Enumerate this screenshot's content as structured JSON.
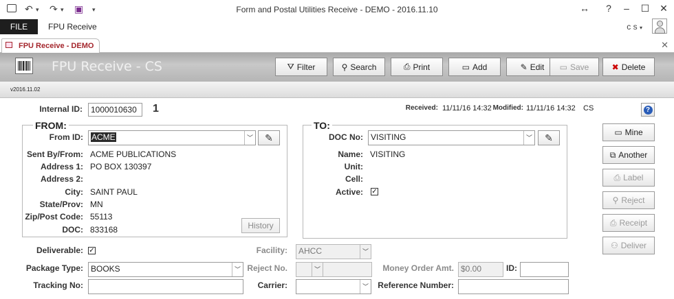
{
  "window": {
    "title": "Form and Postal Utilities Receive - DEMO - 2016.11.10",
    "controls": {
      "resize": "↔",
      "help": "?",
      "minimize": "–",
      "maximize": "☐",
      "close": "✕"
    }
  },
  "qat": {
    "undo": "↶",
    "redo": "↷",
    "save": "▣",
    "more": "▾"
  },
  "ribbon": {
    "file": "FILE",
    "tab": "FPU Receive",
    "user": "c s"
  },
  "doc_tab": {
    "label": "FPU Receive - DEMO",
    "close": "✕"
  },
  "header": {
    "title": "FPU Receive - CS",
    "version": "v2016.11.02"
  },
  "toolbar": {
    "filter": "Filter",
    "search": "Search",
    "print": "Print",
    "add": "Add",
    "edit": "Edit",
    "save": "Save",
    "delete": "Delete"
  },
  "info": {
    "internal_id_label": "Internal ID:",
    "internal_id": "1000010630",
    "count": "1",
    "received_label": "Received:",
    "received": "11/11/16 14:32",
    "modified_label": "Modified:",
    "modified": "11/11/16 14:32",
    "user": "CS"
  },
  "from": {
    "heading": "FROM:",
    "from_id_label": "From ID:",
    "from_id": "ACME",
    "sent_by_label": "Sent By/From:",
    "sent_by": "ACME PUBLICATIONS",
    "address1_label": "Address 1:",
    "address1": "PO BOX 130397",
    "address2_label": "Address 2:",
    "address2": "",
    "city_label": "City:",
    "city": "SAINT PAUL",
    "state_label": "State/Prov:",
    "state": "MN",
    "zip_label": "Zip/Post Code:",
    "zip": "55113",
    "doc_label": "DOC:",
    "doc": "833168",
    "history_button": "History"
  },
  "to": {
    "heading": "TO:",
    "doc_no_label": "DOC No:",
    "doc_no": "VISITING",
    "name_label": "Name:",
    "name": "VISITING",
    "unit_label": "Unit:",
    "unit": "",
    "cell_label": "Cell:",
    "cell": "",
    "active_label": "Active:",
    "active_checked": "✓"
  },
  "bottom": {
    "deliverable_label": "Deliverable:",
    "deliverable_checked": "✓",
    "facility_label": "Facility:",
    "facility": "AHCC",
    "package_type_label": "Package Type:",
    "package_type": "BOOKS",
    "reject_no_label": "Reject No.",
    "money_order_label": "Money Order Amt.",
    "money_order": "$0.00",
    "id_label": "ID:",
    "tracking_label": "Tracking No:",
    "tracking": "",
    "carrier_label": "Carrier:",
    "carrier": "",
    "reference_label": "Reference Number:",
    "reference": ""
  },
  "side_buttons": {
    "help": "?",
    "mine": "Mine",
    "another": "Another",
    "label": "Label",
    "reject": "Reject",
    "receipt": "Receipt",
    "deliver": "Deliver"
  },
  "colors": {
    "accent": "#a4262c",
    "header_band": "#b5b5b5",
    "file_tab": "#1e1e1e"
  }
}
